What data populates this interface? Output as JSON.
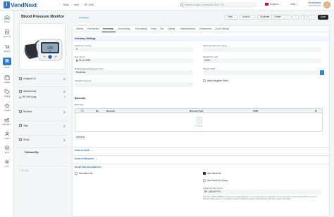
{
  "app": {
    "logo_letter": "i",
    "logo_text": "VendNext"
  },
  "breadcrumb": [
    "Stock",
    "Item",
    "BP-1001"
  ],
  "search": {
    "placeholder": "Search or type a command (Ctrl + G)"
  },
  "topnav": {
    "language": "English",
    "help": "Help",
    "user_name": "Administrator",
    "user_sub": "Administrator"
  },
  "rail": [
    "Home",
    "Account",
    "Buying",
    "Stock",
    "Retail",
    "Selling",
    "Loyalty",
    "Manufac...",
    "Users",
    "Price",
    "Core"
  ],
  "rail_active_index": 3,
  "header": {
    "title": "Blood Pressure Monitor",
    "status": "Enabled",
    "buttons": {
      "view": "View",
      "actions": "Actions",
      "duplicate": "Duplicate",
      "create": "Create",
      "save": "Save"
    }
  },
  "sidebar": {
    "assigned_to": "Assigned To",
    "attachments": "Attachments",
    "attachment_file": "BP-1001.png",
    "reviews": "Reviews",
    "tags": "Tags",
    "share": "Share",
    "followed_by": "Followed By",
    "likes": "0",
    "comments": "0"
  },
  "tabs": [
    "Details",
    "Dashboard",
    "Inventory",
    "Accounting",
    "Purchasing",
    "Sales",
    "Tax",
    "Quality",
    "Manufacturing",
    "Ecommerce",
    "Cross Selling"
  ],
  "active_tab": "Inventory",
  "inventory": {
    "section_title": "Inventory Settings",
    "shelf_life_label": "Shelf Life In Days",
    "shelf_life_value": "0",
    "end_of_life_label": "End of Life",
    "end_of_life_value": "31-12-2099",
    "default_mr_label": "Default Material Request Type",
    "default_mr_value": "Purchase",
    "valuation_label": "Valuation Method",
    "valuation_value": "",
    "warranty_label": "Warranty Period (in days)",
    "warranty_value": "",
    "weight_label": "Weight Per Unit",
    "weight_value": "0.000",
    "weight_uom_label": "Weight UOM",
    "weight_uom_value": "",
    "allow_negative_label": "Allow Negative Stock",
    "allow_negative_checked": false
  },
  "barcodes": {
    "section_title": "Barcodes",
    "grid_label": "Barcodes",
    "columns": [
      "No.",
      "Barcode",
      "Barcode Type",
      "UOM"
    ],
    "empty_text": "No Data",
    "add_row": "Add Row"
  },
  "collapsed_sections": [
    "Auto re-order",
    "Units of Measure"
  ],
  "serial": {
    "section_title": "Serial Nos and Batches",
    "has_batch_label": "Has Batch No",
    "has_batch_checked": false,
    "has_serial_label": "Has Serial No",
    "has_serial_checked": true,
    "has_expiry_label": "Has Serial No Query",
    "has_expiry_checked": false,
    "series_label": "Serial Number Series",
    "series_value": "BP-.DM.MYYYY.-",
    "help_text": "Example: ABCD.##### If series is set and Serial No is not mentioned in transactions, then automatic serial number will be created based on this series. If you always want to explicitly mention Serial Nos for this item, leave this blank."
  },
  "colors": {
    "accent": "#2f7bd1",
    "dark": "#1f272e"
  }
}
